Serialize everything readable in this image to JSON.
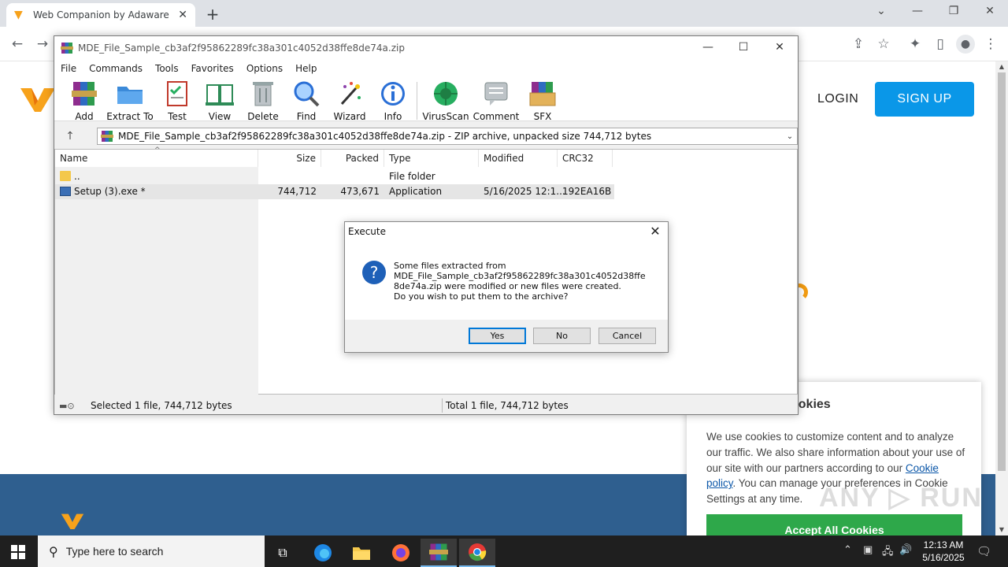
{
  "browser": {
    "tab_title": "Web Companion by Adaware - I",
    "tab_close": "✕",
    "new_tab": "+",
    "win_controls": [
      "⌄",
      "—",
      "❐",
      "✕"
    ]
  },
  "site": {
    "login": "LOGIN",
    "signup": "SIGN UP",
    "cookie": {
      "title": "ookies",
      "body_before_link": "We use cookies to customize content and to analyze our traffic. We also share information about your use of our site with our partners according to our ",
      "link": "Cookie policy",
      "body_after_link": ". You can manage your preferences in Cookie Settings at any time.",
      "accept": "Accept All Cookies"
    },
    "watermark": "ANY ▷ RUN"
  },
  "winrar": {
    "title": "MDE_File_Sample_cb3af2f95862289fc38a301c4052d38ffe8de74a.zip",
    "menu": [
      "File",
      "Commands",
      "Tools",
      "Favorites",
      "Options",
      "Help"
    ],
    "tools": [
      {
        "label": "Add",
        "icon": "add-icon",
        "color": "#c0392b"
      },
      {
        "label": "Extract To",
        "icon": "extract-to-icon",
        "color": "#3b8ad9"
      },
      {
        "label": "Test",
        "icon": "test-icon",
        "color": "#c0392b"
      },
      {
        "label": "View",
        "icon": "view-icon",
        "color": "#2e8b57"
      },
      {
        "label": "Delete",
        "icon": "delete-icon",
        "color": "#7f8c8d"
      },
      {
        "label": "Find",
        "icon": "find-icon",
        "color": "#2a6fd6"
      },
      {
        "label": "Wizard",
        "icon": "wizard-icon",
        "color": "#8e44ad"
      },
      {
        "label": "Info",
        "icon": "info-icon",
        "color": "#2a6fd6"
      },
      {
        "label": "VirusScan",
        "icon": "virusscan-icon",
        "color": "#27ae60"
      },
      {
        "label": "Comment",
        "icon": "comment-icon",
        "color": "#7f8c8d"
      },
      {
        "label": "SFX",
        "icon": "sfx-icon",
        "color": "#d35400"
      }
    ],
    "address": "MDE_File_Sample_cb3af2f95862289fc38a301c4052d38ffe8de74a.zip - ZIP archive, unpacked size 744,712 bytes",
    "columns": [
      "Name",
      "Size",
      "Packed",
      "Type",
      "Modified",
      "CRC32"
    ],
    "rows": [
      {
        "name": "..",
        "size": "",
        "packed": "",
        "type": "File folder",
        "modified": "",
        "crc": ""
      },
      {
        "name": "Setup (3).exe *",
        "size": "744,712",
        "packed": "473,671",
        "type": "Application",
        "modified": "5/16/2025 12:1...",
        "crc": "192EA16B"
      }
    ],
    "status_left": "Selected 1 file, 744,712 bytes",
    "status_right": "Total 1 file, 744,712 bytes"
  },
  "dialog": {
    "title": "Execute",
    "message_line1": "Some files extracted from",
    "message_line2": "MDE_File_Sample_cb3af2f95862289fc38a301c4052d38ffe8de74a.zip were modified or new files were created.",
    "message_line3": "Do you wish to put them to the archive?",
    "yes": "Yes",
    "no": "No",
    "cancel": "Cancel"
  },
  "taskbar": {
    "search_placeholder": "Type here to search",
    "time": "12:13 AM",
    "date": "5/16/2025"
  }
}
